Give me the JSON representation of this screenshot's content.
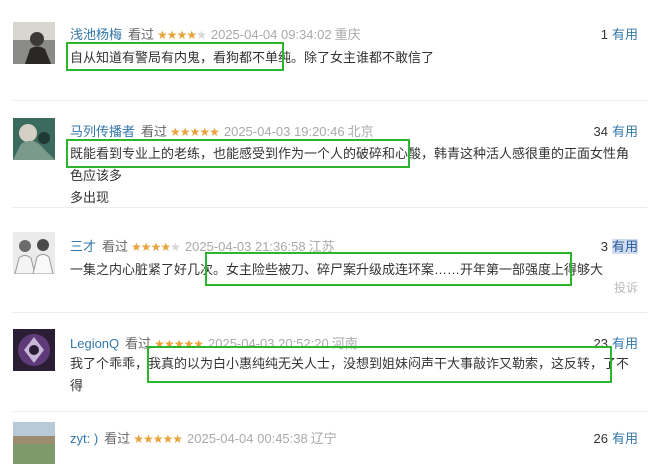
{
  "reviews": [
    {
      "user": "浅池杨梅",
      "status": "看过",
      "rating": 4,
      "date": "2025-04-04 09:34:02",
      "location": "重庆",
      "useful_count": "1",
      "useful_label": "有用",
      "lines": [
        "自从知道有警局有内鬼，看狗都不单纯。除了女主谁都不敢信了"
      ]
    },
    {
      "user": "马列传播者",
      "status": "看过",
      "rating": 5,
      "date": "2025-04-03 19:20:46",
      "location": "北京",
      "useful_count": "34",
      "useful_label": "有用",
      "lines": [
        "既能看到专业上的老练，也能感受到作为一个人的破碎和心酸，韩青这种活人感很重的正面女性角色应该多",
        "多出现"
      ]
    },
    {
      "user": "三才",
      "status": "看过",
      "rating": 4,
      "date": "2025-04-03 21:36:58",
      "location": "江苏",
      "useful_count": "3",
      "useful_label": "有用",
      "lines": [
        "一集之内心脏紧了好几次。女主险些被刀、碎尸案升级成连环案……开年第一部强度上得够大"
      ],
      "report": "投诉"
    },
    {
      "user": "LegionQ",
      "status": "看过",
      "rating": 5,
      "date": "2025-04-03 20:52:20",
      "location": "河南",
      "useful_count": "23",
      "useful_label": "有用",
      "lines": [
        "我了个乖乖，我真的以为白小惠纯纯无关人士，没想到姐妹闷声干大事敲诈又勒索，这反转，了不得"
      ]
    },
    {
      "user": "zyt: )",
      "status": "看过",
      "rating": 5,
      "date": "2025-04-04 00:45:38",
      "location": "辽宁",
      "useful_count": "26",
      "useful_label": "有用",
      "lines": []
    }
  ],
  "colors": {
    "highlight": "#2db52d",
    "star": "#e8a33b",
    "username": "#3377aa"
  },
  "icons": {
    "star": "star-icon"
  }
}
